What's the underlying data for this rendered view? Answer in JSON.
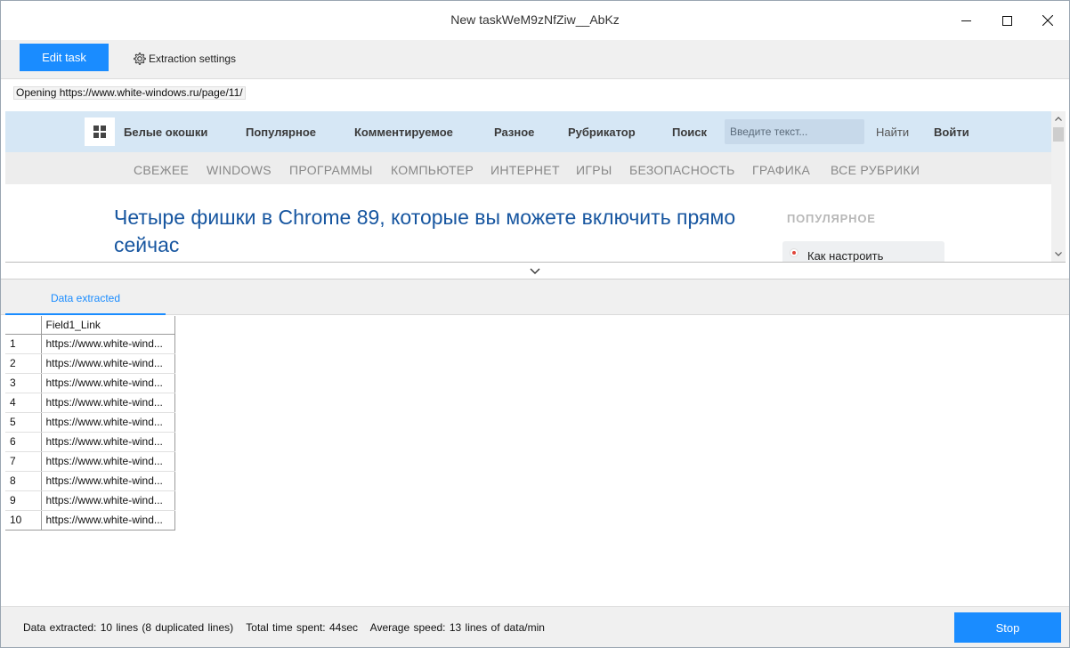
{
  "window": {
    "title": "New taskWeM9zNfZiw__AbKz"
  },
  "toolbar": {
    "edit_task_label": "Edit task",
    "extraction_settings_label": "Extraction settings"
  },
  "loading_status": "Opening https://www.white-windows.ru/page/11/",
  "site": {
    "nav": {
      "brand": "Белые окошки",
      "links": [
        "Популярное",
        "Комментируемое",
        "Разное",
        "Рубрикатор",
        "Поиск"
      ],
      "search_placeholder": "Введите текст...",
      "find_label": "Найти",
      "login_label": "Войти"
    },
    "categories": [
      "СВЕЖЕЕ",
      "WINDOWS",
      "ПРОГРАММЫ",
      "КОМПЬЮТЕР",
      "ИНТЕРНЕТ",
      "ИГРЫ",
      "БЕЗОПАСНОСТЬ",
      "ГРАФИКА",
      "ВСЕ РУБРИКИ"
    ],
    "article_title": "Четыре фишки в Chrome 89, которые вы можете включить прямо сейчас",
    "sidebar": {
      "heading": "ПОПУЛЯРНОЕ",
      "first_item": "Как настроить"
    }
  },
  "tabs": {
    "data_extracted": "Data extracted"
  },
  "table": {
    "column_header": "Field1_Link",
    "rows": [
      {
        "index": "1",
        "link": "https://www.white-wind..."
      },
      {
        "index": "2",
        "link": "https://www.white-wind..."
      },
      {
        "index": "3",
        "link": "https://www.white-wind..."
      },
      {
        "index": "4",
        "link": "https://www.white-wind..."
      },
      {
        "index": "5",
        "link": "https://www.white-wind..."
      },
      {
        "index": "6",
        "link": "https://www.white-wind..."
      },
      {
        "index": "7",
        "link": "https://www.white-wind..."
      },
      {
        "index": "8",
        "link": "https://www.white-wind..."
      },
      {
        "index": "9",
        "link": "https://www.white-wind..."
      },
      {
        "index": "10",
        "link": "https://www.white-wind..."
      }
    ]
  },
  "footer": {
    "data_extracted": "Data extracted: 10 lines (8 duplicated lines)",
    "time_spent": "Total time spent: 44sec",
    "avg_speed": "Average speed: 13 lines of data/min",
    "stop_label": "Stop"
  },
  "colors": {
    "accent": "#1a8cff",
    "site_nav_bg": "#d6e7f5",
    "article_title": "#1756a0"
  },
  "icons": {
    "minimize": "minimize-icon",
    "maximize": "maximize-icon",
    "close": "close-icon",
    "settings": "gear-icon",
    "collapse": "chevron-down-icon",
    "site_logo": "windows-logo-icon"
  }
}
